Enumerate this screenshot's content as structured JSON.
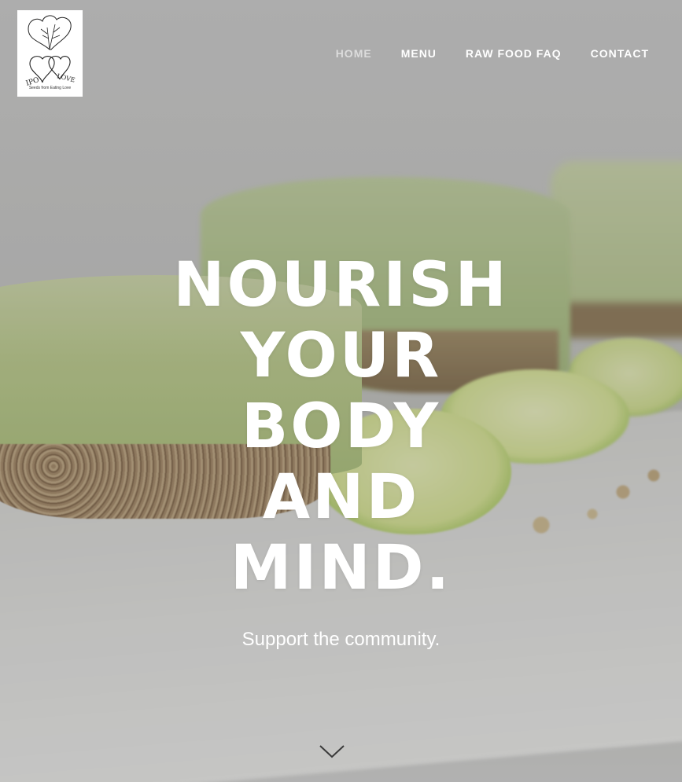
{
  "logo": {
    "alt": "IPO LOVE logo",
    "caption": "Seeds from Eating Love"
  },
  "nav": {
    "items": [
      {
        "label": "HOME",
        "active": true
      },
      {
        "label": "MENU",
        "active": false
      },
      {
        "label": "RAW FOOD FAQ",
        "active": false
      },
      {
        "label": "CONTACT",
        "active": false
      }
    ]
  },
  "hero": {
    "headline_lines": [
      "NOURISH",
      "YOUR",
      "BODY",
      "AND",
      "MIND."
    ],
    "subtitle": "Support the community.",
    "scroll_icon": "chevron-down-icon"
  },
  "colors": {
    "nav_text": "#ffffff",
    "nav_active": "#dcdcdc",
    "headline": "#ffffff"
  }
}
